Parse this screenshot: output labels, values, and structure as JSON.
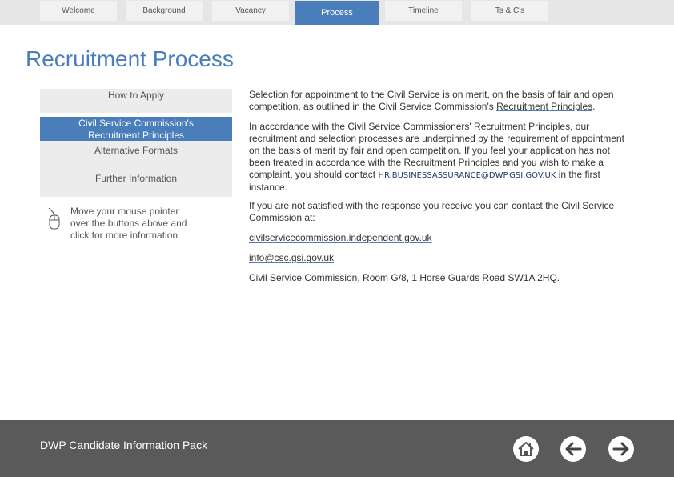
{
  "tabs": [
    {
      "label": "Welcome"
    },
    {
      "label": "Background"
    },
    {
      "label": "Vacancy"
    },
    {
      "label": "Process"
    },
    {
      "label": "Timeline"
    },
    {
      "label": "Ts & C's"
    }
  ],
  "page": {
    "title": "Recruitment Process"
  },
  "nav": {
    "how_to_apply": "How to Apply",
    "csc_principles_line1": "Civil Service Commission's",
    "csc_principles_line2": "Recruitment Principles",
    "alternative_formats": "Alternative Formats",
    "further_information": "Further Information",
    "hint": "Move your mouse pointer over the buttons above and click for more information."
  },
  "content": {
    "p1_text": "Selection for appointment to the Civil Service is on merit, on the basis of fair and open competition, as outlined in the Civil Service Commission's ",
    "p1_link": "Recruitment Principles",
    "p1_end": ".",
    "p2_text": "In accordance with the Civil Service Commissioners' Recruitment Principles, our recruitment and selection processes are underpinned by the requirement of appointment on the basis of merit by fair and open competition. If you feel your application has not been treated in accordance with the Recruitment Principles and you wish to make a complaint, you should contact ",
    "p2_email": "HR.BUSINESSASSURANCE@DWP.GSI.GOV.UK",
    "p2_end": " in the first instance.",
    "p3_text": "If you are not satisfied with the response you receive you can contact the Civil Service Commission at:",
    "website_link": "civilservicecommission.independent.gov.uk",
    "email_link": "info@csc.gsi.gov.uk",
    "address": "Civil Service Commission, Room G/8, 1 Horse Guards Road SW1A 2HQ."
  },
  "footer": {
    "title": "DWP Candidate Information Pack",
    "home_icon": "home-icon",
    "back_icon": "arrow-left-icon",
    "forward_icon": "arrow-right-icon"
  },
  "colors": {
    "accent": "#4a7ebb",
    "footer_bg": "#5a5a5a"
  }
}
